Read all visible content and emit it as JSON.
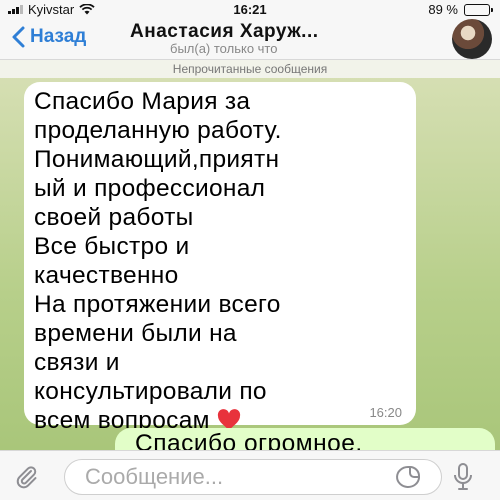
{
  "status_bar": {
    "carrier": "Kyivstar",
    "time": "16:21",
    "battery": "89 %",
    "battery_level": 0.89,
    "icons": [
      "signal-icon",
      "wifi-icon",
      "battery-icon"
    ]
  },
  "header": {
    "back_label": "Назад",
    "title": "Анастасия Харуж...",
    "subtitle": "был(а) только что",
    "icons": [
      "chevron-left-icon",
      "avatar"
    ]
  },
  "chat": {
    "unread_banner": "Непрочитанные сообщения",
    "incoming": {
      "text": "Спасибо Мария за\nпроделанную работу.\nПонимающий,приятн\nый и профессионал\nсвоей работы\nВсе быстро и\nкачественно\nНа протяжении всего\nвремени были на\nсвязи и\nконсультировали по\nвсем вопросам",
      "emoji": "heart-icon",
      "time": "16:20"
    },
    "outgoing": {
      "text": "Спасибо огромное."
    }
  },
  "input_bar": {
    "placeholder": "Сообщение...",
    "value": "",
    "icons": [
      "paperclip-icon",
      "sticker-icon",
      "microphone-icon"
    ]
  },
  "colors": {
    "accent": "#2f7fd6",
    "incoming_bubble": "#ffffff",
    "outgoing_bubble": "#e2fec8",
    "heart": "#e8323c"
  }
}
